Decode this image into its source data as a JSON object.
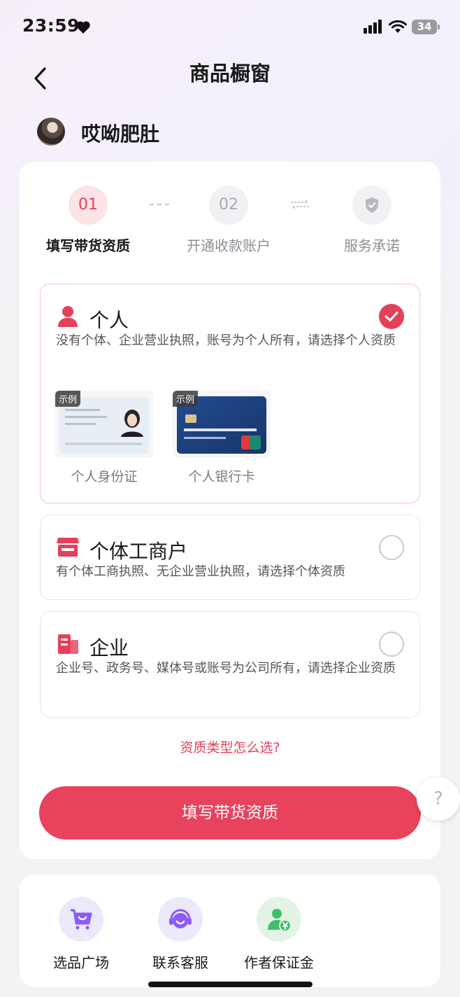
{
  "status_bar": {
    "time": "23:59",
    "battery": "34"
  },
  "header": {
    "title": "商品橱窗"
  },
  "user": {
    "name": "哎呦肥肚"
  },
  "steps": [
    {
      "number": "01",
      "label": "填写带货资质"
    },
    {
      "number": "02",
      "label": "开通收款账户"
    },
    {
      "number": "",
      "label": "服务承诺"
    }
  ],
  "options": {
    "personal": {
      "title": "个人",
      "desc": "没有个体、企业营业执照，账号为个人所有，请选择个人资质",
      "selected": true,
      "examples": [
        {
          "tag": "示例",
          "label": "个人身份证"
        },
        {
          "tag": "示例",
          "label": "个人银行卡"
        }
      ]
    },
    "individual": {
      "title": "个体工商户",
      "desc": "有个体工商执照、无企业营业执照，请选择个体资质",
      "selected": false
    },
    "enterprise": {
      "title": "企业",
      "desc": "企业号、政务号、媒体号或账号为公司所有，请选择企业资质",
      "selected": false
    }
  },
  "help_link": "资质类型怎么选?",
  "primary_button": "填写带货资质",
  "float_help": "?",
  "shortcuts": [
    {
      "label": "选品广场",
      "icon": "cart-icon"
    },
    {
      "label": "联系客服",
      "icon": "headset-icon"
    },
    {
      "label": "作者保证金",
      "icon": "deposit-icon"
    }
  ],
  "colors": {
    "accent": "#e5405a",
    "accent_light": "#fbe3e6",
    "purple": "#8b5cf6",
    "green": "#3fbf6a"
  }
}
